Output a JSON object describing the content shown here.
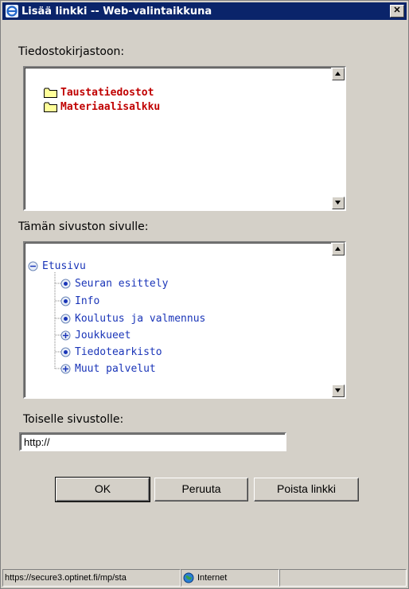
{
  "window": {
    "title": "Lisää linkki -- Web-valintaikkuna",
    "close_label": "✕"
  },
  "file_library": {
    "label": "Tiedostokirjastoon:",
    "folders": [
      {
        "label": "Taustatiedostot",
        "icon": "folder-icon"
      },
      {
        "label": "Materiaalisalkku",
        "icon": "folder-icon"
      }
    ]
  },
  "site_pages": {
    "label": "Tämän sivuston sivulle:",
    "root": {
      "label": "Etusivu",
      "expanded": true
    },
    "children": [
      {
        "label": "Seuran esittely",
        "has_children": false
      },
      {
        "label": "Info",
        "has_children": false
      },
      {
        "label": "Koulutus ja valmennus",
        "has_children": false
      },
      {
        "label": "Joukkueet",
        "has_children": true
      },
      {
        "label": "Tiedotearkisto",
        "has_children": false
      },
      {
        "label": "Muut palvelut",
        "has_children": true
      }
    ]
  },
  "external": {
    "label": "Toiselle sivustolle:",
    "value": "http://"
  },
  "buttons": {
    "ok": "OK",
    "cancel": "Peruuta",
    "remove": "Poista linkki"
  },
  "statusbar": {
    "url": "https://secure3.optinet.fi/mp/sta",
    "zone": "Internet"
  },
  "colors": {
    "titlebar": "#0a246a",
    "folder_text": "#c00000",
    "tree_text": "#1a35b8",
    "folder_fill": "#ffff99"
  }
}
